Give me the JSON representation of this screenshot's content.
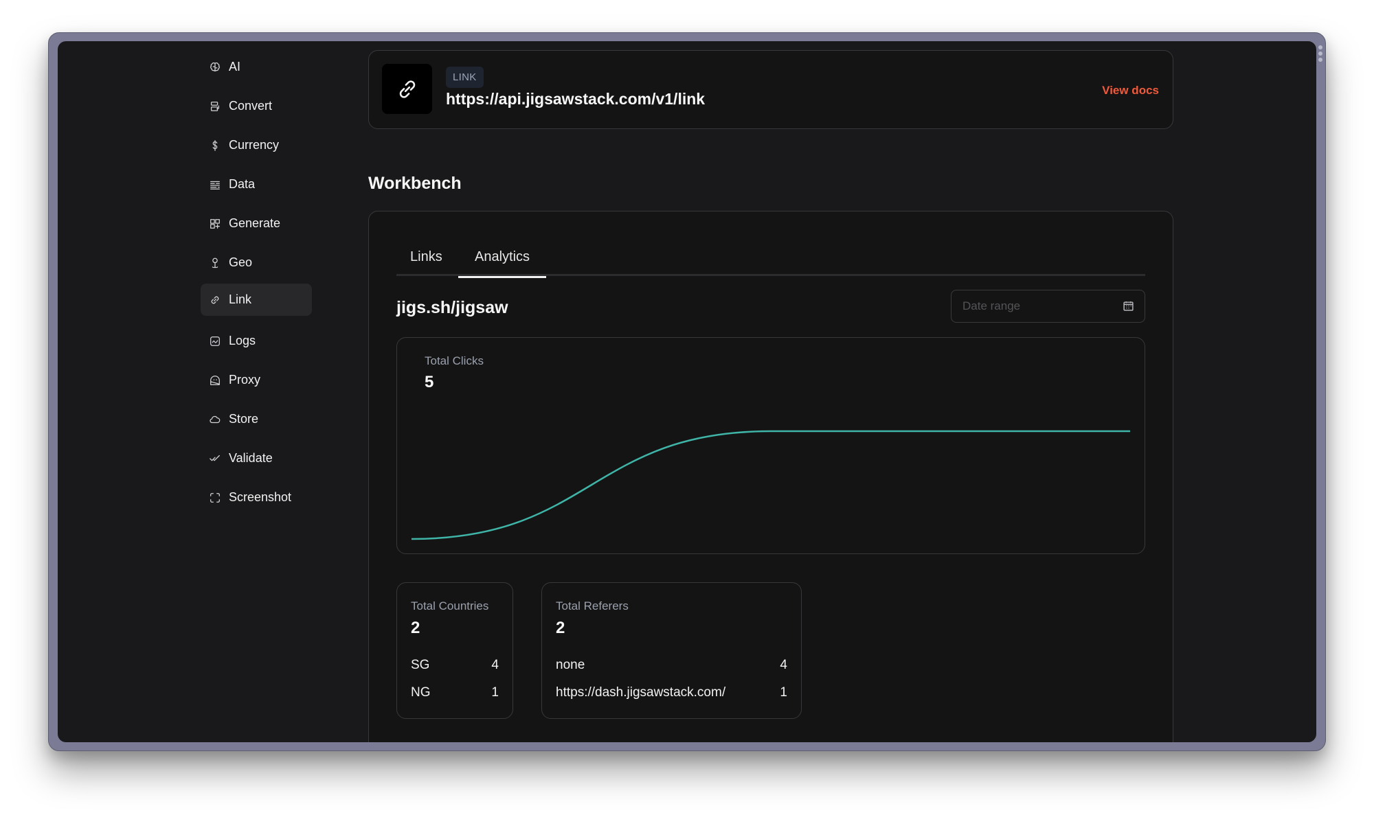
{
  "sidebar": {
    "items": [
      {
        "label": "AI",
        "icon": "brain-icon"
      },
      {
        "label": "Convert",
        "icon": "convert-icon"
      },
      {
        "label": "Currency",
        "icon": "dollar-icon"
      },
      {
        "label": "Data",
        "icon": "data-lines-icon"
      },
      {
        "label": "Generate",
        "icon": "grid-plus-icon"
      },
      {
        "label": "Geo",
        "icon": "map-pin-icon"
      },
      {
        "label": "Link",
        "icon": "link-icon",
        "active": true
      },
      {
        "label": "Logs",
        "icon": "chart-box-icon"
      },
      {
        "label": "Proxy",
        "icon": "proxy-icon"
      },
      {
        "label": "Store",
        "icon": "cloud-icon"
      },
      {
        "label": "Validate",
        "icon": "double-check-icon"
      },
      {
        "label": "Screenshot",
        "icon": "screenshot-frame-icon"
      }
    ]
  },
  "endpoint": {
    "badge": "LINK",
    "url": "https://api.jigsawstack.com/v1/link",
    "docs_label": "View docs"
  },
  "workbench": {
    "title": "Workbench",
    "tabs": [
      {
        "label": "Links",
        "active": false
      },
      {
        "label": "Analytics",
        "active": true
      }
    ],
    "short_link": "jigs.sh/jigsaw",
    "date_placeholder": "Date range",
    "total_clicks": {
      "label": "Total Clicks",
      "value": "5"
    },
    "total_countries": {
      "label": "Total Countries",
      "value": "2",
      "rows": [
        {
          "name": "SG",
          "count": "4"
        },
        {
          "name": "NG",
          "count": "1"
        }
      ]
    },
    "total_referers": {
      "label": "Total Referers",
      "value": "2",
      "rows": [
        {
          "name": "none",
          "count": "4"
        },
        {
          "name": "https://dash.jigsawstack.com/",
          "count": "1"
        }
      ]
    }
  },
  "colors": {
    "accent": "#ee5a3c",
    "line": "#3fb5a8",
    "background": "#19191b",
    "card": "#151415"
  },
  "chart_data": {
    "type": "line",
    "title": "Total Clicks",
    "x": [
      0,
      1,
      2
    ],
    "series": [
      {
        "name": "clicks",
        "values": [
          0,
          5,
          5
        ]
      }
    ],
    "ylim": [
      0,
      5
    ],
    "grid": false,
    "axes_visible": false,
    "interpolation": "monotone"
  }
}
